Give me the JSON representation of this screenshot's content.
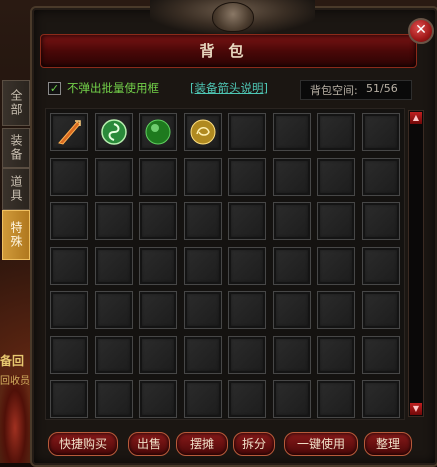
{
  "window": {
    "title": "背包",
    "close_symbol": "✕"
  },
  "options": {
    "checkbox_checked": true,
    "checkbox_label": "不弹出批量使用框",
    "help_link": "[装备箭头说明]",
    "space_label": "背包空间:",
    "space_value": "51/56"
  },
  "tabs": [
    {
      "label": "全部",
      "active": false
    },
    {
      "label": "装备",
      "active": false
    },
    {
      "label": "道具",
      "active": false
    },
    {
      "label": "特殊",
      "active": true
    }
  ],
  "inventory": {
    "columns": 8,
    "rows": 7,
    "items": [
      {
        "slot": 0,
        "icon": "flame-sword-icon"
      },
      {
        "slot": 1,
        "icon": "green-swirl-orb-icon"
      },
      {
        "slot": 2,
        "icon": "green-jade-orb-icon"
      },
      {
        "slot": 3,
        "icon": "golden-dragon-orb-icon"
      }
    ]
  },
  "buttons": [
    {
      "label": "快捷购买",
      "name": "quick-buy-button"
    },
    {
      "label": "出售",
      "name": "sell-button"
    },
    {
      "label": "摆摊",
      "name": "stall-button"
    },
    {
      "label": "拆分",
      "name": "split-button"
    },
    {
      "label": "一键使用",
      "name": "one-click-use-button"
    },
    {
      "label": "整理",
      "name": "sort-button"
    }
  ],
  "background": {
    "text1": "备回",
    "text2": "回收员"
  },
  "colors": {
    "accent_green": "#73d24a",
    "link_teal": "#4ec6b4",
    "title_red": "#7a1414",
    "active_tab": "#d09a3a"
  }
}
